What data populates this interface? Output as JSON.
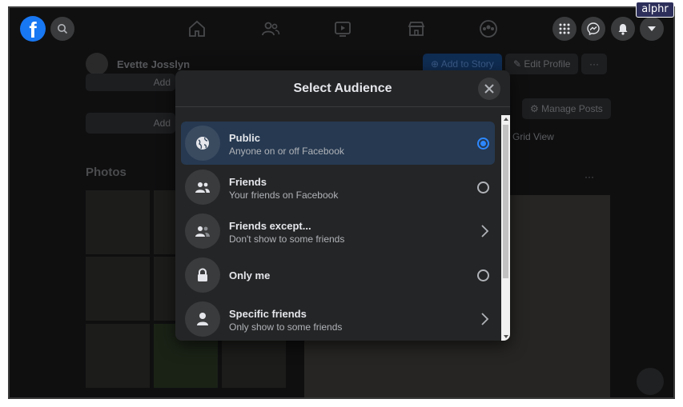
{
  "watermark": "alphr",
  "topbar": {
    "logo_letter": "f",
    "nav_icons": [
      "home-icon",
      "friends-icon",
      "watch-icon",
      "marketplace-icon",
      "groups-icon"
    ],
    "right_icons": [
      "menu-grid-icon",
      "messenger-icon",
      "notifications-icon",
      "account-caret-icon"
    ]
  },
  "profile": {
    "name": "Evette Josslyn",
    "add_story": "Add to Story",
    "edit_profile": "Edit Profile",
    "more": "···",
    "manage_posts": "Manage Posts",
    "grid_view": "Grid View",
    "photos_label": "Photos",
    "partial_add": "Add",
    "partial_add2": "Add"
  },
  "modal": {
    "title": "Select Audience",
    "options": [
      {
        "title": "Public",
        "subtitle": "Anyone on or off Facebook",
        "control": "radio",
        "selected": true,
        "icon": "globe-icon"
      },
      {
        "title": "Friends",
        "subtitle": "Your friends on Facebook",
        "control": "radio",
        "selected": false,
        "icon": "friends-icon"
      },
      {
        "title": "Friends except...",
        "subtitle": "Don't show to some friends",
        "control": "chevron",
        "selected": false,
        "icon": "friends-except-icon"
      },
      {
        "title": "Only me",
        "subtitle": "",
        "control": "radio",
        "selected": false,
        "icon": "lock-icon"
      },
      {
        "title": "Specific friends",
        "subtitle": "Only show to some friends",
        "control": "chevron",
        "selected": false,
        "icon": "person-icon"
      }
    ]
  },
  "colors": {
    "accent": "#2d88ff",
    "brand": "#1877f2",
    "modal_bg": "#242526",
    "selected_bg": "#263951"
  }
}
